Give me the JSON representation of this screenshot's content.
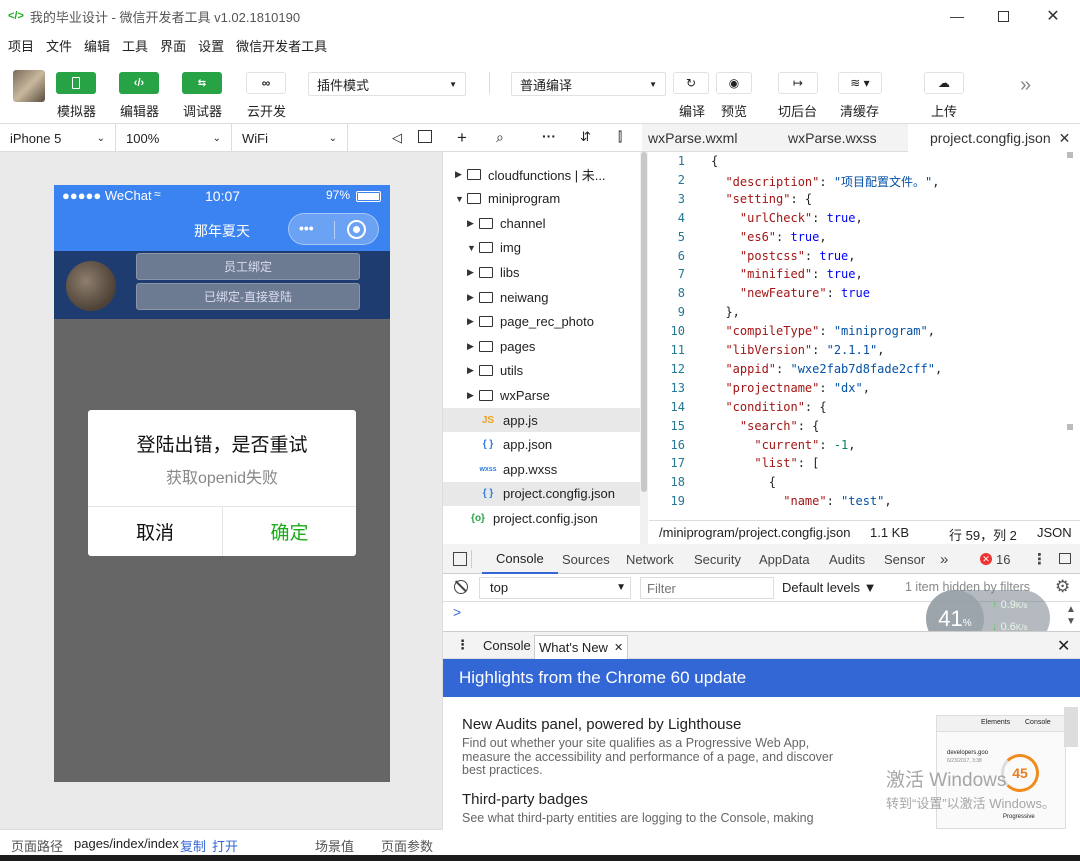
{
  "window": {
    "title": "我的毕业设计 - 微信开发者工具 v1.02.1810190",
    "logo": "</>"
  },
  "menu": [
    "项目",
    "文件",
    "编辑",
    "工具",
    "界面",
    "设置",
    "微信开发者工具"
  ],
  "toolbar": {
    "simulator": "模拟器",
    "editor": "编辑器",
    "debugger": "调试器",
    "cloud": "云开发",
    "plugin_mode": "插件模式",
    "compile_mode": "普通编译",
    "compile": "编译",
    "preview": "预览",
    "background": "切后台",
    "clear_cache": "清缓存",
    "upload": "上传"
  },
  "device": {
    "model": "iPhone 5",
    "zoom": "100%",
    "network": "WiFi"
  },
  "phone": {
    "carrier": "●●●●● WeChat",
    "time": "10:07",
    "battery": "97%",
    "nav_title": "那年夏天",
    "btn_bind": "员工绑定",
    "btn_login": "已绑定-直接登陆",
    "modal_title": "登陆出错，是否重试",
    "modal_msg": "获取openid失败",
    "modal_cancel": "取消",
    "modal_ok": "确定"
  },
  "filetree": [
    {
      "label": "cloudfunctions | 未...",
      "type": "folder",
      "level": 0,
      "open": false
    },
    {
      "label": "miniprogram",
      "type": "folder",
      "level": 0,
      "open": true
    },
    {
      "label": "channel",
      "type": "folder",
      "level": 1,
      "open": false
    },
    {
      "label": "img",
      "type": "folder",
      "level": 1,
      "open": true
    },
    {
      "label": "libs",
      "type": "folder",
      "level": 1,
      "open": false
    },
    {
      "label": "neiwang",
      "type": "folder",
      "level": 1,
      "open": false
    },
    {
      "label": "page_rec_photo",
      "type": "folder",
      "level": 1,
      "open": false
    },
    {
      "label": "pages",
      "type": "folder",
      "level": 1,
      "open": false
    },
    {
      "label": "utils",
      "type": "folder",
      "level": 1,
      "open": false
    },
    {
      "label": "wxParse",
      "type": "folder",
      "level": 1,
      "open": false
    },
    {
      "label": "app.js",
      "type": "js",
      "level": 1
    },
    {
      "label": "app.json",
      "type": "json",
      "level": 1
    },
    {
      "label": "app.wxss",
      "type": "wxss",
      "level": 1
    },
    {
      "label": "project.congfig.json",
      "type": "json",
      "level": 1
    },
    {
      "label": "project.config.json",
      "type": "config",
      "level": 0
    }
  ],
  "tabs": [
    "wxParse.wxml",
    "wxParse.wxss",
    "project.congfig.json"
  ],
  "code_lines": [
    [
      [
        "p",
        "{"
      ]
    ],
    [
      [
        "k",
        "  \"description\""
      ],
      [
        "p",
        ": "
      ],
      [
        "s",
        "\"项目配置文件。\""
      ],
      [
        "p",
        ","
      ]
    ],
    [
      [
        "k",
        "  \"setting\""
      ],
      [
        "p",
        ": {"
      ]
    ],
    [
      [
        "k",
        "    \"urlCheck\""
      ],
      [
        "p",
        ": "
      ],
      [
        "b",
        "true"
      ],
      [
        "p",
        ","
      ]
    ],
    [
      [
        "k",
        "    \"es6\""
      ],
      [
        "p",
        ": "
      ],
      [
        "b",
        "true"
      ],
      [
        "p",
        ","
      ]
    ],
    [
      [
        "k",
        "    \"postcss\""
      ],
      [
        "p",
        ": "
      ],
      [
        "b",
        "true"
      ],
      [
        "p",
        ","
      ]
    ],
    [
      [
        "k",
        "    \"minified\""
      ],
      [
        "p",
        ": "
      ],
      [
        "b",
        "true"
      ],
      [
        "p",
        ","
      ]
    ],
    [
      [
        "k",
        "    \"newFeature\""
      ],
      [
        "p",
        ": "
      ],
      [
        "b",
        "true"
      ]
    ],
    [
      [
        "p",
        "  },"
      ]
    ],
    [
      [
        "k",
        "  \"compileType\""
      ],
      [
        "p",
        ": "
      ],
      [
        "s",
        "\"miniprogram\""
      ],
      [
        "p",
        ","
      ]
    ],
    [
      [
        "k",
        "  \"libVersion\""
      ],
      [
        "p",
        ": "
      ],
      [
        "s",
        "\"2.1.1\""
      ],
      [
        "p",
        ","
      ]
    ],
    [
      [
        "k",
        "  \"appid\""
      ],
      [
        "p",
        ": "
      ],
      [
        "s",
        "\"wxe2fab7d8fade2cff\""
      ],
      [
        "p",
        ","
      ]
    ],
    [
      [
        "k",
        "  \"projectname\""
      ],
      [
        "p",
        ": "
      ],
      [
        "s",
        "\"dx\""
      ],
      [
        "p",
        ","
      ]
    ],
    [
      [
        "k",
        "  \"condition\""
      ],
      [
        "p",
        ": {"
      ]
    ],
    [
      [
        "k",
        "    \"search\""
      ],
      [
        "p",
        ": {"
      ]
    ],
    [
      [
        "k",
        "      \"current\""
      ],
      [
        "p",
        ": "
      ],
      [
        "n",
        "-1"
      ],
      [
        "p",
        ","
      ]
    ],
    [
      [
        "k",
        "      \"list\""
      ],
      [
        "p",
        ": ["
      ]
    ],
    [
      [
        "p",
        "        {"
      ]
    ],
    [
      [
        "k",
        "          \"name\""
      ],
      [
        "p",
        ": "
      ],
      [
        "s",
        "\"test\""
      ],
      [
        "p",
        ","
      ]
    ]
  ],
  "editor_status": {
    "path": "/miniprogram/project.congfig.json",
    "size": "1.1 KB",
    "position": "行 59，列 2",
    "lang": "JSON"
  },
  "devtools_tabs": [
    "Console",
    "Sources",
    "Network",
    "Security",
    "AppData",
    "Audits",
    "Sensor"
  ],
  "devtools_errors": "16",
  "console": {
    "context": "top",
    "filter_placeholder": "Filter",
    "levels": "Default levels ▼",
    "hidden": "1 item hidden by filters",
    "prompt": ">"
  },
  "overlay": {
    "cpu": "41",
    "cpu_unit": "%",
    "up": "0.9",
    "down": "0.6",
    "speed_unit": "K/s"
  },
  "drawer": {
    "tab1": "Console",
    "tab2": "What's New"
  },
  "whatsnew": {
    "title": "Highlights from the Chrome 60 update",
    "h1": "New Audits panel, powered by Lighthouse",
    "p1": "Find out whether your site qualifies as a Progressive Web App, measure the accessibility and performance of a page, and discover best practices.",
    "h2": "Third-party badges",
    "p2": "See what third-party entities are logging to the Console, making",
    "thumb_tabs": [
      "Elements",
      "Console"
    ],
    "thumb_url": "developers.goo",
    "thumb_date": "6/23/2017, 3:38",
    "thumb_score": "45",
    "thumb_label": "Progressive",
    "watermark1": "激活 Windows",
    "watermark2": "转到“设置”以激活 Windows。"
  },
  "bottom": {
    "path_label": "页面路径",
    "path": "pages/index/index",
    "copy": "复制",
    "open": "打开",
    "scene": "场景值",
    "params": "页面参数"
  },
  "colors": {
    "green": "#27a345",
    "nav_blue": "#3b83f0",
    "ok_green": "#1aad19",
    "banner_blue": "#3367d6"
  }
}
